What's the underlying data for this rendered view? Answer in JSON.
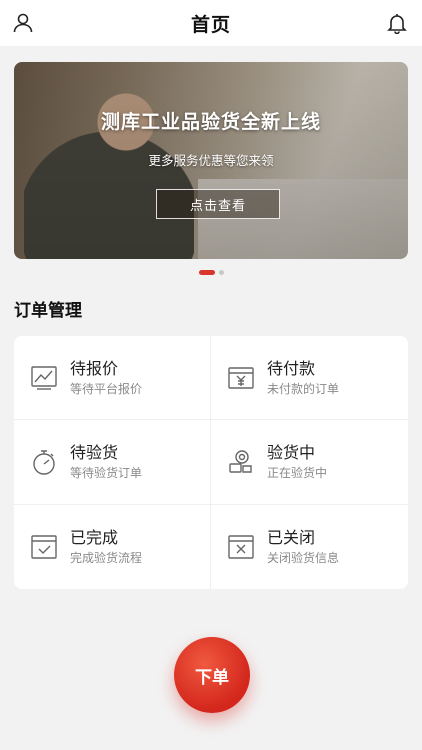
{
  "header": {
    "title": "首页",
    "user_icon": "user-icon",
    "bell_icon": "bell-icon"
  },
  "banner": {
    "headline": "测库工业品验货全新上线",
    "subtitle": "更多服务优惠等您来领",
    "cta_label": "点击查看"
  },
  "carousel": {
    "count": 2,
    "active_index": 0
  },
  "orders": {
    "section_title": "订单管理",
    "items": [
      {
        "title": "待报价",
        "desc": "等待平台报价",
        "icon": "chart-line-icon"
      },
      {
        "title": "待付款",
        "desc": "未付款的订单",
        "icon": "yen-icon"
      },
      {
        "title": "待验货",
        "desc": "等待验货订单",
        "icon": "stopwatch-icon"
      },
      {
        "title": "验货中",
        "desc": "正在验货中",
        "icon": "inspector-icon"
      },
      {
        "title": "已完成",
        "desc": "完成验货流程",
        "icon": "checkbox-icon"
      },
      {
        "title": "已关闭",
        "desc": "关闭验货信息",
        "icon": "close-box-icon"
      }
    ]
  },
  "actions": {
    "place_order_label": "下单"
  },
  "colors": {
    "accent": "#d9362b",
    "background": "#f2f2f2",
    "card": "#ffffff"
  }
}
